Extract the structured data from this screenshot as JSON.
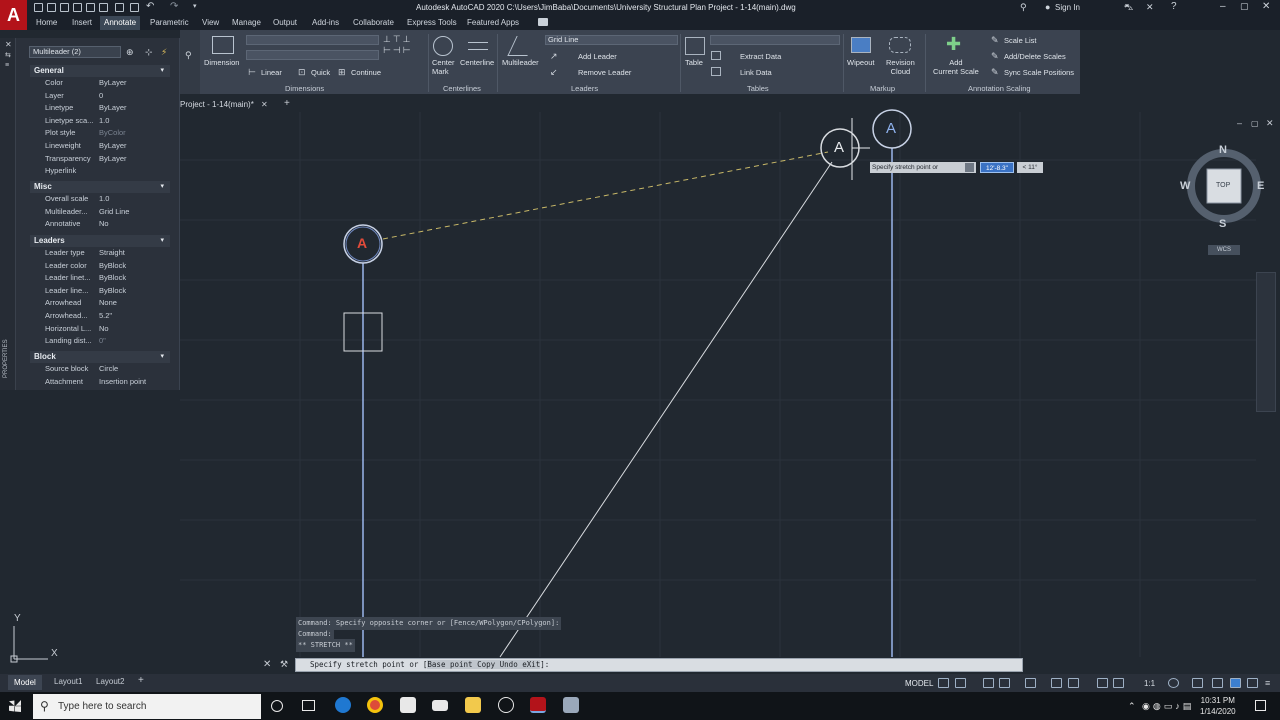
{
  "title_bar": {
    "app_letter": "A",
    "title": "Autodesk AutoCAD 2020   C:\\Users\\JimBaba\\Documents\\University Structural Plan Project - 1-14(main).dwg",
    "sign_in": "Sign In"
  },
  "ribbon_tabs": [
    "Home",
    "Insert",
    "Annotate",
    "Parametric",
    "View",
    "Manage",
    "Output",
    "Add-ins",
    "Collaborate",
    "Express Tools",
    "Featured Apps"
  ],
  "active_tab": "Annotate",
  "ribbon": {
    "dimension_label": "Dimension",
    "linear_label": "Linear",
    "quick_label": "Quick",
    "continue_label": "Continue",
    "dimensions_panel": "Dimensions",
    "center_mark_label": "Center\nMark",
    "centerline_label": "Centerline",
    "centerlines_panel": "Centerlines",
    "multileader_label": "Multileader",
    "leader_style": "Grid Line",
    "add_leader_label": "Add Leader",
    "remove_leader_label": "Remove Leader",
    "leaders_panel": "Leaders",
    "table_label": "Table",
    "extract_data_label": "Extract Data",
    "link_data_label": "Link Data",
    "tables_panel": "Tables",
    "wipeout_label": "Wipeout",
    "revision_cloud_label": "Revision\nCloud",
    "markup_panel": "Markup",
    "add_current_scale_label": "Add\nCurrent Scale",
    "scale_list_label": "Scale List",
    "add_delete_scales_label": "Add/Delete Scales",
    "sync_scale_positions_label": "Sync Scale Positions",
    "annotation_scaling_panel": "Annotation Scaling"
  },
  "properties": {
    "selection": "Multileader (2)",
    "strip_label": "PROPERTIES",
    "sections": [
      {
        "title": "General",
        "rows": [
          {
            "label": "Color",
            "value": "ByLayer"
          },
          {
            "label": "Layer",
            "value": "0"
          },
          {
            "label": "Linetype",
            "value": "ByLayer"
          },
          {
            "label": "Linetype sca...",
            "value": "1.0"
          },
          {
            "label": "Plot style",
            "value": "ByColor"
          },
          {
            "label": "Lineweight",
            "value": "ByLayer"
          },
          {
            "label": "Transparency",
            "value": "ByLayer"
          },
          {
            "label": "Hyperlink",
            "value": ""
          }
        ]
      },
      {
        "title": "Misc",
        "rows": [
          {
            "label": "Overall scale",
            "value": "1.0"
          },
          {
            "label": "Multileader...",
            "value": "Grid Line"
          },
          {
            "label": "Annotative",
            "value": "No"
          }
        ]
      },
      {
        "title": "Leaders",
        "rows": [
          {
            "label": "Leader type",
            "value": "Straight"
          },
          {
            "label": "Leader color",
            "value": "ByBlock"
          },
          {
            "label": "Leader linet...",
            "value": "ByBlock"
          },
          {
            "label": "Leader line...",
            "value": "ByBlock"
          },
          {
            "label": "Arrowhead",
            "value": "None"
          },
          {
            "label": "Arrowhead...",
            "value": "5.2\""
          },
          {
            "label": "Horizontal L...",
            "value": "No"
          },
          {
            "label": "Landing dist...",
            "value": "0\""
          }
        ]
      },
      {
        "title": "Block",
        "rows": [
          {
            "label": "Source block",
            "value": "Circle"
          },
          {
            "label": "Attachment",
            "value": "Insertion point"
          }
        ]
      }
    ]
  },
  "drawing": {
    "file_tab": "Project - 1-14(main)*",
    "bubble_letters": [
      "A",
      "A",
      "A"
    ],
    "tooltip_prompt": "Specify stretch point or",
    "tooltip_value1": "12'-8.3\"",
    "tooltip_value2": "< 11°",
    "ucs_x": "X",
    "ucs_y": "Y",
    "viewcube": {
      "top": "TOP",
      "n": "N",
      "s": "S",
      "e": "E",
      "w": "W",
      "wcs": "WCS"
    }
  },
  "command_line": {
    "history": [
      "Command: Specify opposite corner or [Fence/WPolygon/CPolygon]:",
      "Command:",
      "** STRETCH **"
    ],
    "input_prefix": "Specify stretch point or [",
    "input_options": "Base point Copy Undo eXit",
    "input_suffix": "]:"
  },
  "layout_tabs": [
    "Model",
    "Layout1",
    "Layout2"
  ],
  "status_bar": {
    "model": "MODEL",
    "scale": "1:1"
  },
  "taskbar": {
    "search_placeholder": "Type here to search",
    "time": "10:31 PM",
    "date": "1/14/2020"
  },
  "colors": {
    "background": "#212830",
    "grid_line": "#9bb6ea",
    "leader_dash": "#c9b968",
    "accent_red": "#b3131a"
  }
}
